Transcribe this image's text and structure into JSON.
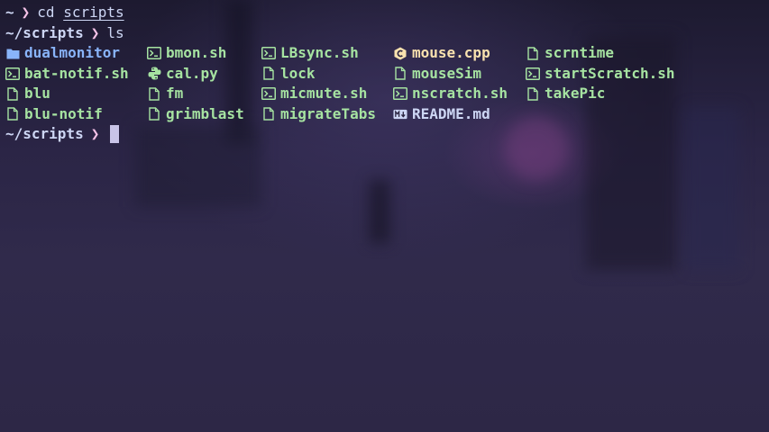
{
  "colors": {
    "directory": "#89b4fa",
    "executable": "#a6e3a1",
    "source_cpp": "#f9e2af",
    "prompt_chevron": "#f5c2e7",
    "text": "#cdd6f4",
    "cursor": "#c9c4e8"
  },
  "terminal": {
    "line1": {
      "cwd": "~",
      "chevron": "❯",
      "command": "cd",
      "argument": "scripts"
    },
    "line2": {
      "cwd": "~/scripts",
      "chevron": "❯",
      "command": "ls"
    },
    "listing": {
      "columns": [
        [
          {
            "name": "dualmonitor",
            "icon": "folder-icon",
            "kind": "directory"
          },
          {
            "name": "bat-notif.sh",
            "icon": "terminal-icon",
            "kind": "executable"
          },
          {
            "name": "blu",
            "icon": "file-icon",
            "kind": "file"
          },
          {
            "name": "blu-notif",
            "icon": "file-icon",
            "kind": "file"
          }
        ],
        [
          {
            "name": "bmon.sh",
            "icon": "terminal-icon",
            "kind": "executable"
          },
          {
            "name": "cal.py",
            "icon": "python-icon",
            "kind": "executable"
          },
          {
            "name": "fm",
            "icon": "file-icon",
            "kind": "file"
          },
          {
            "name": "grimblast",
            "icon": "file-icon",
            "kind": "file"
          }
        ],
        [
          {
            "name": "LBsync.sh",
            "icon": "terminal-icon",
            "kind": "executable"
          },
          {
            "name": "lock",
            "icon": "file-icon",
            "kind": "file"
          },
          {
            "name": "micmute.sh",
            "icon": "terminal-icon",
            "kind": "executable"
          },
          {
            "name": "migrateTabs",
            "icon": "file-icon",
            "kind": "file"
          }
        ],
        [
          {
            "name": "mouse.cpp",
            "icon": "cpp-icon",
            "kind": "source"
          },
          {
            "name": "mouseSim",
            "icon": "file-icon",
            "kind": "file"
          },
          {
            "name": "nscratch.sh",
            "icon": "terminal-icon",
            "kind": "executable"
          },
          {
            "name": "README.md",
            "icon": "markdown-icon",
            "kind": "file"
          }
        ],
        [
          {
            "name": "scrntime",
            "icon": "file-icon",
            "kind": "file"
          },
          {
            "name": "startScratch.sh",
            "icon": "terminal-icon",
            "kind": "executable"
          },
          {
            "name": "takePic",
            "icon": "file-icon",
            "kind": "file"
          }
        ]
      ]
    },
    "line3": {
      "cwd": "~/scripts",
      "chevron": "❯"
    }
  }
}
